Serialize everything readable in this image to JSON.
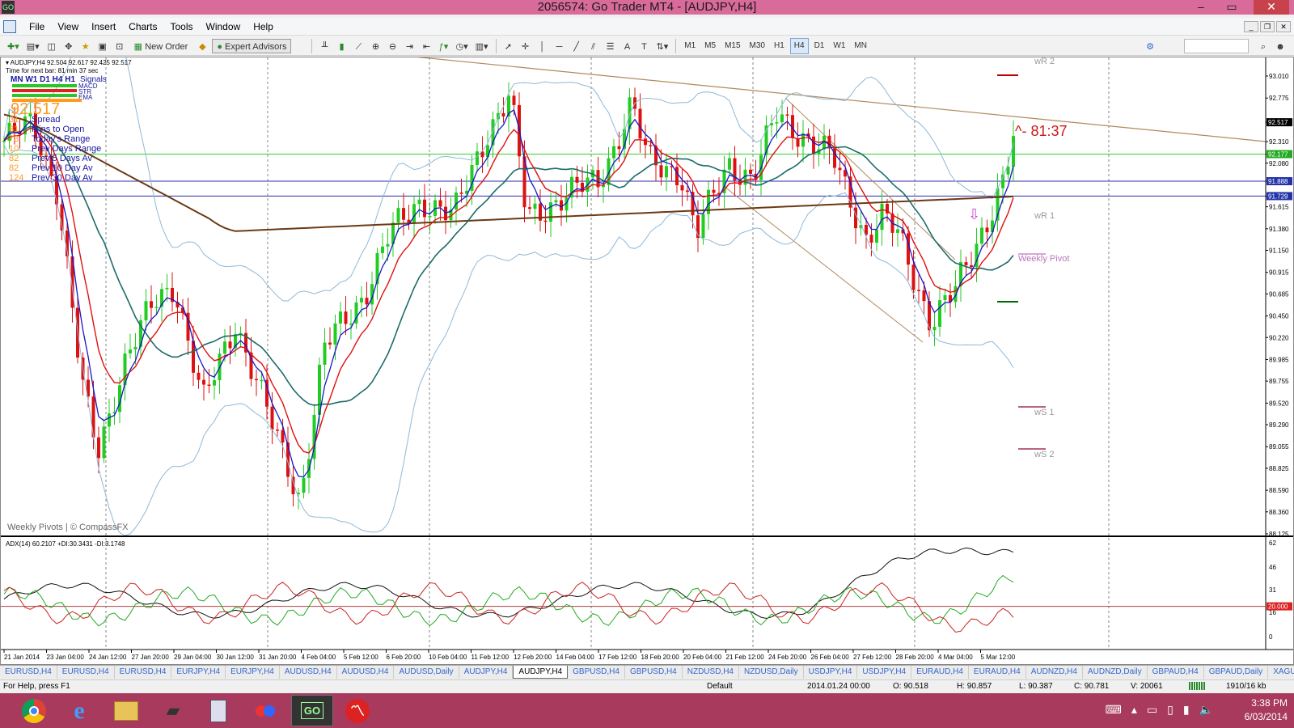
{
  "window": {
    "title": "2056574: Go Trader MT4 - [AUDJPY,H4]",
    "icon_label": "GO"
  },
  "menu": [
    "File",
    "View",
    "Insert",
    "Charts",
    "Tools",
    "Window",
    "Help"
  ],
  "toolbar": {
    "new_order": "New Order",
    "expert_advisors": "Expert Advisors",
    "timeframes": [
      "M1",
      "M5",
      "M15",
      "M30",
      "H1",
      "H4",
      "D1",
      "W1",
      "MN"
    ],
    "active_timeframe": "H4"
  },
  "chart": {
    "symbol_header": "AUDJPY,H4  92.504 92.617 92.425 92.517",
    "next_bar": "Time for next bar: 81 min 37 sec",
    "signals_tf": "MN W1 D1  H4  H1",
    "signals_label": "Signals",
    "signal_rows": [
      "MACD",
      "STR",
      "EMA"
    ],
    "price_big": "92.517",
    "info_panel": [
      {
        "value": "31",
        "label": "Spread"
      },
      {
        "value": "81",
        "label": "Mins to Open"
      },
      {
        "value": "73",
        "label": "Today's Range"
      },
      {
        "value": "10",
        "label": "Prev Days Range"
      },
      {
        "value": "82",
        "label": "Prev 5 Days Av"
      },
      {
        "value": "82",
        "label": "Prev 10 Day Av"
      },
      {
        "value": "124",
        "label": "Prev 30 Day Av"
      }
    ],
    "countdown": "^- 81:37",
    "pivot_labels": {
      "wr2": "wR 2",
      "wr1": "wR 1",
      "weekly_pivot": "Weekly Pivot",
      "ws1": "wS 1",
      "ws2": "wS 2"
    },
    "watermark": "Weekly Pivots | © CompassFX",
    "adx_header": "ADX(14) 60.2107 +DI:30.3431 -DI:3.1748",
    "price_axis": [
      "93.010",
      "92.775",
      "92.517",
      "92.310",
      "92.177",
      "92.080",
      "91.888",
      "91.729",
      "91.615",
      "91.380",
      "91.150",
      "90.915",
      "90.685",
      "90.450",
      "90.220",
      "89.985",
      "89.755",
      "89.520",
      "89.290",
      "89.055",
      "88.825",
      "88.590",
      "88.360",
      "88.125"
    ],
    "price_markers": [
      {
        "label": "92.517",
        "color": "#000000"
      },
      {
        "label": "92.177",
        "color": "#22aa22"
      },
      {
        "label": "91.888",
        "color": "#2233aa"
      },
      {
        "label": "91.729",
        "color": "#2233aa"
      }
    ],
    "adx_axis": [
      "62",
      "46",
      "31",
      "20.000",
      "16",
      "0"
    ],
    "time_axis": [
      "21 Jan 2014",
      "23 Jan 04:00",
      "24 Jan 12:00",
      "27 Jan 20:00",
      "29 Jan 04:00",
      "30 Jan 12:00",
      "31 Jan 20:00",
      "4 Feb 04:00",
      "5 Feb 12:00",
      "6 Feb 20:00",
      "10 Feb 04:00",
      "11 Feb 12:00",
      "12 Feb 20:00",
      "14 Feb 04:00",
      "17 Feb 12:00",
      "18 Feb 20:00",
      "20 Feb 04:00",
      "21 Feb 12:00",
      "24 Feb 20:00",
      "26 Feb 04:00",
      "27 Feb 12:00",
      "28 Feb 20:00",
      "4 Mar 04:00",
      "5 Mar 12:00"
    ]
  },
  "tabs": [
    "EURUSD,H4",
    "EURUSD,H4",
    "EURUSD,H4",
    "EURJPY,H4",
    "EURJPY,H4",
    "AUDUSD,H4",
    "AUDUSD,H4",
    "AUDUSD,Daily",
    "AUDJPY,H4",
    "AUDJPY,H4",
    "GBPUSD,H4",
    "GBPUSD,H4",
    "NZDUSD,H4",
    "NZDUSD,Daily",
    "USDJPY,H4",
    "USDJPY,H4",
    "EURAUD,H4",
    "EURAUD,H4",
    "AUDNZD,H4",
    "AUDNZD,Daily",
    "GBPAUD,H4",
    "GBPAUD,Daily",
    "XAGUSD,H4",
    "XA"
  ],
  "active_tab_index": 9,
  "status": {
    "help": "For Help, press F1",
    "profile": "Default",
    "datetime": "2014.01.24 00:00",
    "open": "O: 90.518",
    "high": "H: 90.857",
    "low": "L: 90.387",
    "close": "C: 90.781",
    "volume": "V: 20061",
    "traffic": "1910/16 kb"
  },
  "taskbar": {
    "time": "3:38 PM",
    "date": "6/03/2014"
  },
  "colors": {
    "title_bar": "#d96b9b",
    "taskbar": "#a83a5e",
    "bull_candle": "#22cc22",
    "bear_candle": "#dd1111",
    "trendline": "#b08a5a"
  }
}
